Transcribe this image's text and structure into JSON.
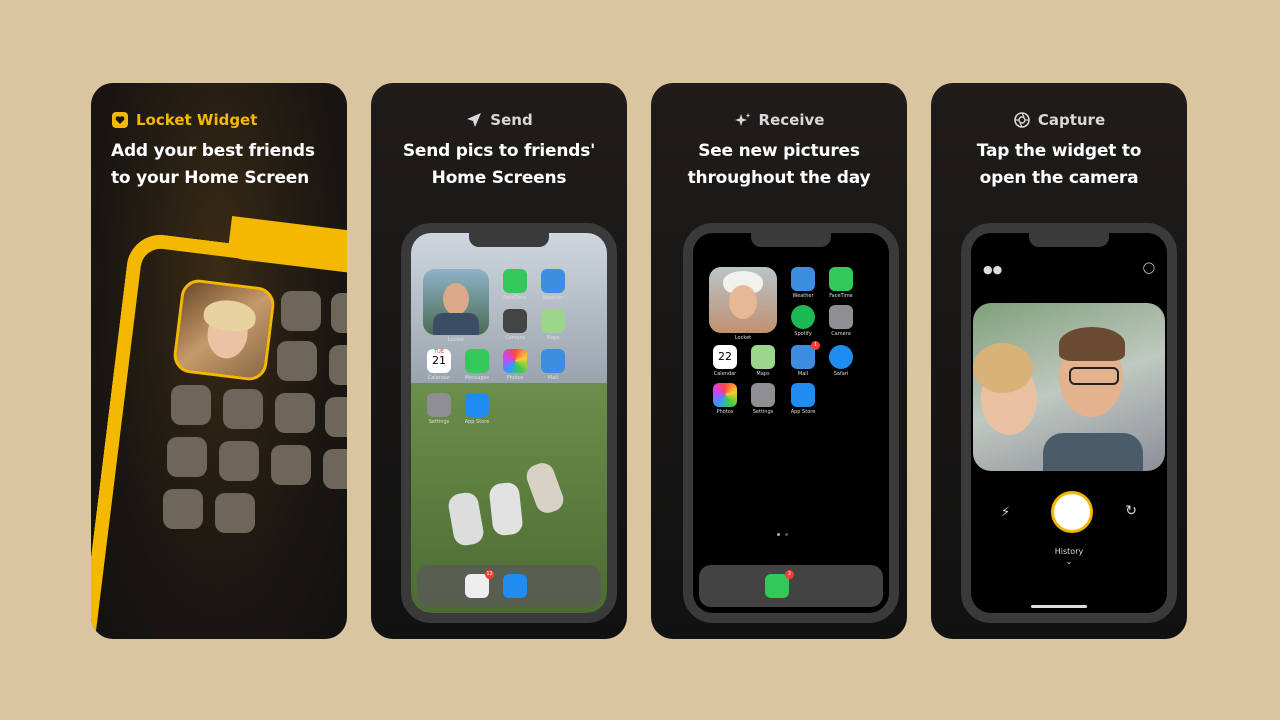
{
  "cards": [
    {
      "tag": "Locket Widget",
      "icon": "heart-icon",
      "line1": "Add your best friends",
      "line2": "to your Home Screen"
    },
    {
      "tag": "Send",
      "icon": "paper-plane-icon",
      "line1": "Send pics to friends'",
      "line2": "Home Screens"
    },
    {
      "tag": "Receive",
      "icon": "sparkles-icon",
      "line1": "See new pictures",
      "line2": "throughout the day"
    },
    {
      "tag": "Capture",
      "icon": "camera-aperture-icon",
      "line1": "Tap the widget to",
      "line2": "open the camera"
    }
  ],
  "phone2": {
    "widget_label": "Locket",
    "apps": [
      "FaceTime",
      "Weather",
      "Camera",
      "Maps",
      "Calendar",
      "Messages",
      "Photos",
      "Mail",
      "Settings",
      "App Store"
    ],
    "calendar_day": "TUE",
    "calendar_date": "21",
    "dock_badge": "12"
  },
  "phone3": {
    "widget_label": "Locket",
    "apps": [
      "Weather",
      "FaceTime",
      "Spotify",
      "Camera",
      "Calendar",
      "Maps",
      "Mail",
      "Safari",
      "Photos",
      "Settings",
      "App Store"
    ],
    "calendar_date": "22",
    "mail_badge": "1",
    "messages_badge": "2"
  },
  "phone4": {
    "history_label": "History"
  },
  "colors": {
    "background": "#d9c6a1",
    "accent": "#f5b800",
    "card": "#151413"
  }
}
